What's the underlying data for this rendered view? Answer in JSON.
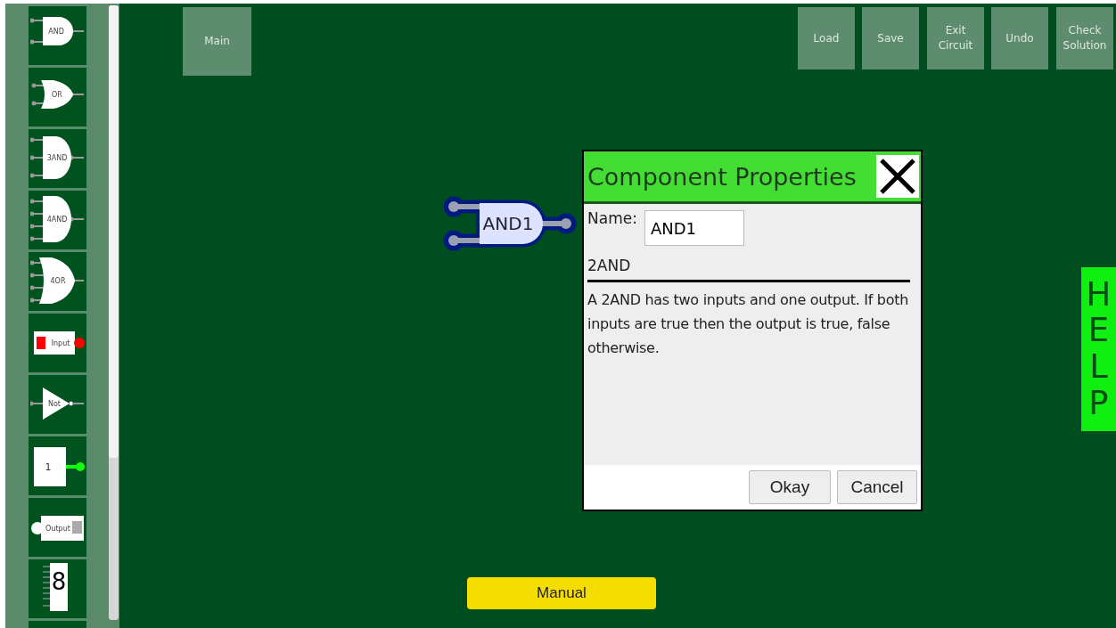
{
  "palette": [
    {
      "kind": "and",
      "label": "AND"
    },
    {
      "kind": "or",
      "label": "OR"
    },
    {
      "kind": "and3",
      "label": "3AND"
    },
    {
      "kind": "and4",
      "label": "4AND"
    },
    {
      "kind": "or4",
      "label": "4OR"
    },
    {
      "kind": "input",
      "label": "Input"
    },
    {
      "kind": "not",
      "label": "Not"
    },
    {
      "kind": "constant",
      "label": "1"
    },
    {
      "kind": "output",
      "label": "Output"
    },
    {
      "kind": "display",
      "label": "8"
    },
    {
      "kind": "blank"
    }
  ],
  "toolbar": {
    "left": [
      "Main"
    ],
    "right": [
      "Load",
      "Save",
      "Exit Circuit",
      "Undo",
      "Check Solution"
    ]
  },
  "gate": {
    "label": "AND1",
    "selected": true
  },
  "dialog": {
    "title": "Component Properties",
    "name_label": "Name:",
    "name_value": "AND1",
    "type": "2AND",
    "description": "A 2AND has two inputs and one output. If both inputs are true then the output is true, false otherwise.",
    "buttons": [
      "Okay",
      "Cancel"
    ]
  },
  "help": "HELP",
  "manual": "Manual"
}
